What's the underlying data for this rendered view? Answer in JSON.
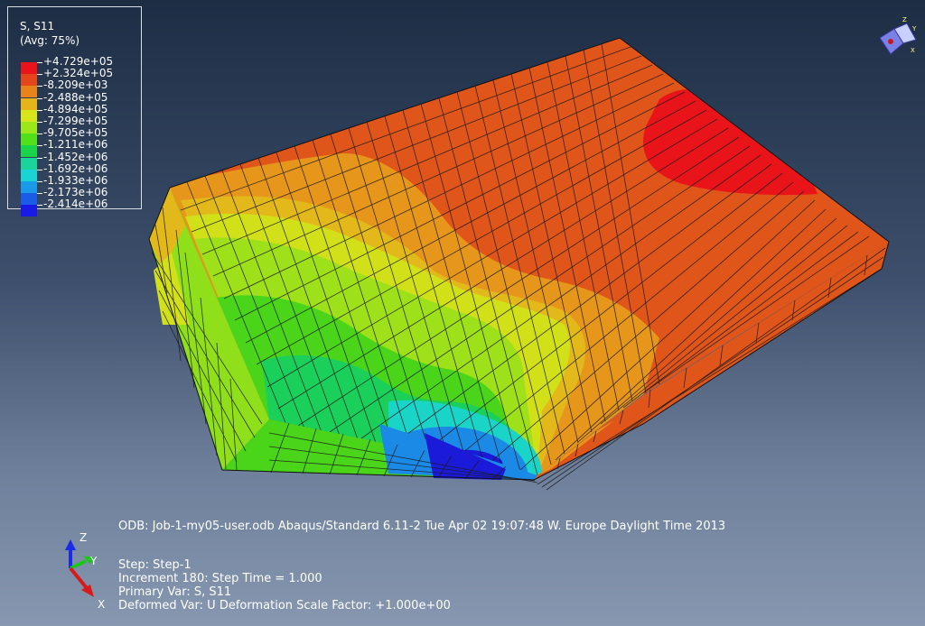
{
  "legend": {
    "title": "S, S11",
    "subtitle": "(Avg: 75%)",
    "entries": [
      {
        "label": "+4.729e+05",
        "color": "#e8141a"
      },
      {
        "label": "+2.324e+05",
        "color": "#e4451a"
      },
      {
        "label": "-8.209e+03",
        "color": "#e8831a"
      },
      {
        "label": "-2.488e+05",
        "color": "#e6b41a"
      },
      {
        "label": "-4.894e+05",
        "color": "#d6e61a"
      },
      {
        "label": "-7.299e+05",
        "color": "#9ae81a"
      },
      {
        "label": "-9.705e+05",
        "color": "#52e01a"
      },
      {
        "label": "-1.211e+06",
        "color": "#1ad44a"
      },
      {
        "label": "-1.452e+06",
        "color": "#1ad49a"
      },
      {
        "label": "-1.692e+06",
        "color": "#1ad4d4"
      },
      {
        "label": "-1.933e+06",
        "color": "#1a9ae8"
      },
      {
        "label": "-2.173e+06",
        "color": "#1a5ce8"
      },
      {
        "label": "-2.414e+06",
        "color": "#1a1ae6"
      }
    ]
  },
  "info": {
    "line1": "ODB: Job-1-my05-user.odb    Abaqus/Standard 6.11-2    Tue Apr 02 19:07:48 W. Europe Daylight Time 2013",
    "line2": "Step: Step-1",
    "line3": "Increment    180: Step Time =    1.000",
    "line4": "Primary Var: S, S11",
    "line5": "Deformed Var: U   Deformation Scale Factor: +1.000e+00"
  },
  "triad": {
    "x": "X",
    "y": "Y",
    "z": "Z"
  },
  "view_cube": {
    "x": "X",
    "y": "Y",
    "z": "Z"
  },
  "colors": {
    "background_top": "#1d2d44",
    "background_bottom": "#8797b0",
    "mesh_line": "#1a1a1a"
  }
}
